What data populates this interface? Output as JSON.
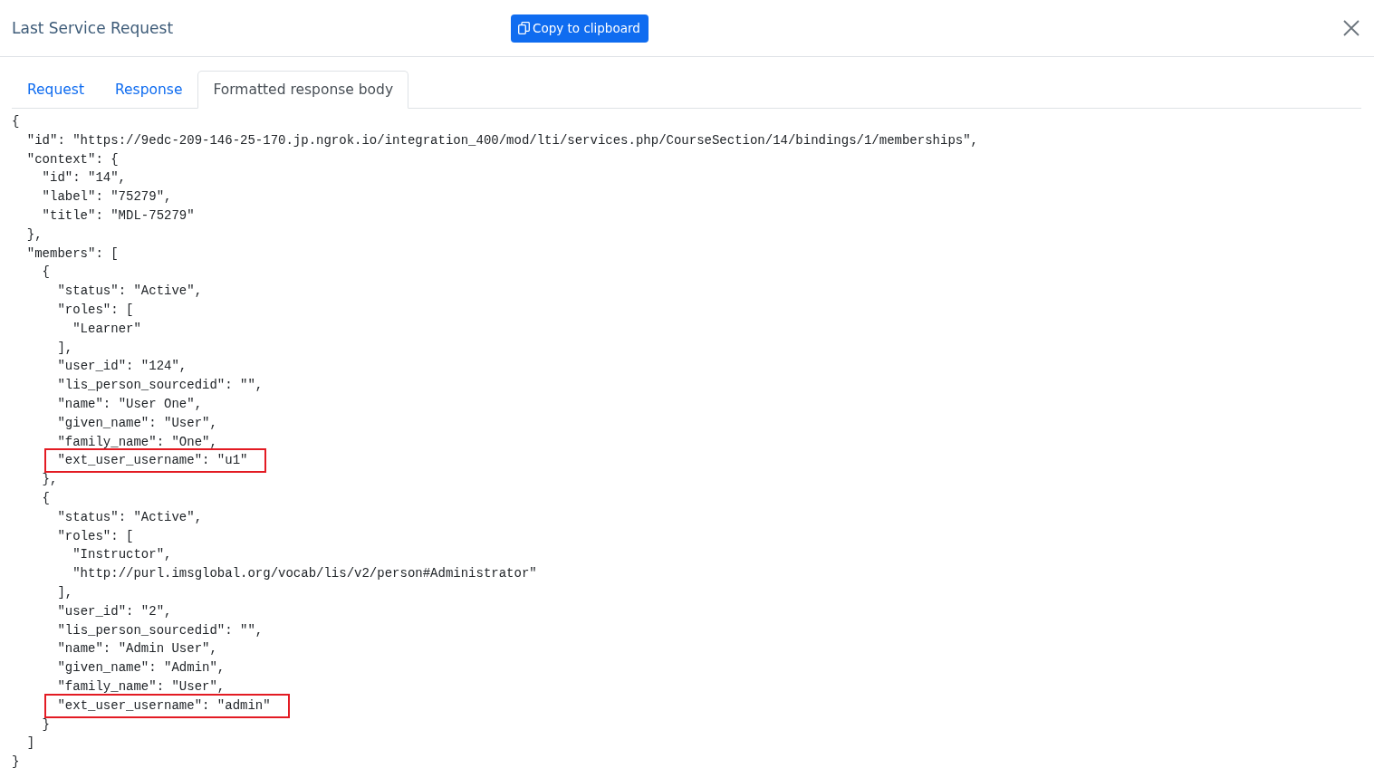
{
  "dialog": {
    "title": "Last Service Request",
    "copy_button": "Copy to clipboard"
  },
  "tabs": [
    {
      "label": "Request",
      "selected": false
    },
    {
      "label": "Response",
      "selected": false
    },
    {
      "label": "Formatted response body",
      "selected": true
    }
  ],
  "code_lines": [
    {
      "text": "{",
      "highlighted": false
    },
    {
      "text": "  \"id\": \"https://9edc-209-146-25-170.jp.ngrok.io/integration_400/mod/lti/services.php/CourseSection/14/bindings/1/memberships\",",
      "highlighted": false
    },
    {
      "text": "  \"context\": {",
      "highlighted": false
    },
    {
      "text": "    \"id\": \"14\",",
      "highlighted": false
    },
    {
      "text": "    \"label\": \"75279\",",
      "highlighted": false
    },
    {
      "text": "    \"title\": \"MDL-75279\"",
      "highlighted": false
    },
    {
      "text": "  },",
      "highlighted": false
    },
    {
      "text": "  \"members\": [",
      "highlighted": false
    },
    {
      "text": "    {",
      "highlighted": false
    },
    {
      "text": "      \"status\": \"Active\",",
      "highlighted": false
    },
    {
      "text": "      \"roles\": [",
      "highlighted": false
    },
    {
      "text": "        \"Learner\"",
      "highlighted": false
    },
    {
      "text": "      ],",
      "highlighted": false
    },
    {
      "text": "      \"user_id\": \"124\",",
      "highlighted": false
    },
    {
      "text": "      \"lis_person_sourcedid\": \"\",",
      "highlighted": false
    },
    {
      "text": "      \"name\": \"User One\",",
      "highlighted": false
    },
    {
      "text": "      \"given_name\": \"User\",",
      "highlighted": false
    },
    {
      "text": "      \"family_name\": \"One\",",
      "highlighted": false
    },
    {
      "text": "      \"ext_user_username\": \"u1\"",
      "highlighted": true
    },
    {
      "text": "    },",
      "highlighted": false
    },
    {
      "text": "    {",
      "highlighted": false
    },
    {
      "text": "      \"status\": \"Active\",",
      "highlighted": false
    },
    {
      "text": "      \"roles\": [",
      "highlighted": false
    },
    {
      "text": "        \"Instructor\",",
      "highlighted": false
    },
    {
      "text": "        \"http://purl.imsglobal.org/vocab/lis/v2/person#Administrator\"",
      "highlighted": false
    },
    {
      "text": "      ],",
      "highlighted": false
    },
    {
      "text": "      \"user_id\": \"2\",",
      "highlighted": false
    },
    {
      "text": "      \"lis_person_sourcedid\": \"\",",
      "highlighted": false
    },
    {
      "text": "      \"name\": \"Admin User\",",
      "highlighted": false
    },
    {
      "text": "      \"given_name\": \"Admin\",",
      "highlighted": false
    },
    {
      "text": "      \"family_name\": \"User\",",
      "highlighted": false
    },
    {
      "text": "      \"ext_user_username\": \"admin\"",
      "highlighted": true
    },
    {
      "text": "    }",
      "highlighted": false
    },
    {
      "text": "  ]",
      "highlighted": false
    },
    {
      "text": "}",
      "highlighted": false
    }
  ]
}
